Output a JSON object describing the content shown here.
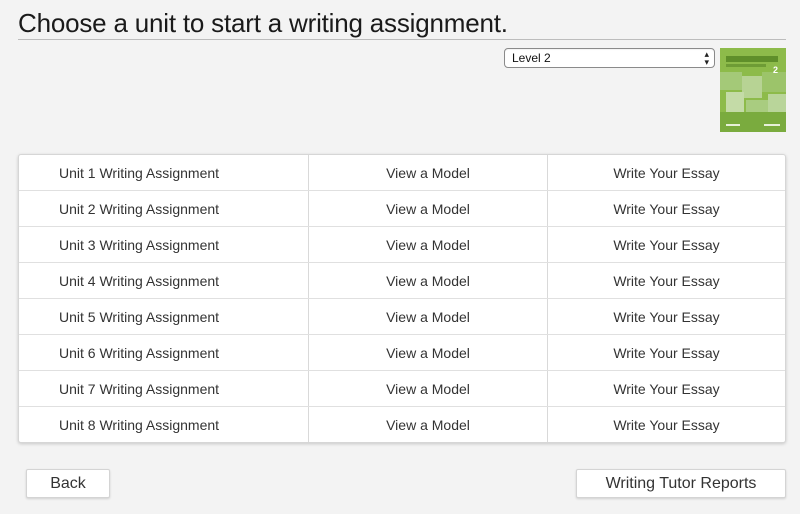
{
  "page": {
    "title": "Choose a unit to start a writing assignment."
  },
  "level_select": {
    "selected": "Level 2"
  },
  "book_cover": {
    "number": "2",
    "color": "#8dbb4a"
  },
  "units": [
    {
      "name": "Unit 1 Writing Assignment",
      "model": "View a Model",
      "essay": "Write Your Essay"
    },
    {
      "name": "Unit 2 Writing Assignment",
      "model": "View a Model",
      "essay": "Write Your Essay"
    },
    {
      "name": "Unit 3 Writing Assignment",
      "model": "View a Model",
      "essay": "Write Your Essay"
    },
    {
      "name": "Unit 4 Writing Assignment",
      "model": "View a Model",
      "essay": "Write Your Essay"
    },
    {
      "name": "Unit 5 Writing Assignment",
      "model": "View a Model",
      "essay": "Write Your Essay"
    },
    {
      "name": "Unit 6 Writing Assignment",
      "model": "View a Model",
      "essay": "Write Your Essay"
    },
    {
      "name": "Unit 7 Writing Assignment",
      "model": "View a Model",
      "essay": "Write Your Essay"
    },
    {
      "name": "Unit 8 Writing Assignment",
      "model": "View a Model",
      "essay": "Write Your Essay"
    }
  ],
  "footer": {
    "back_label": "Back",
    "reports_label": "Writing Tutor Reports"
  }
}
